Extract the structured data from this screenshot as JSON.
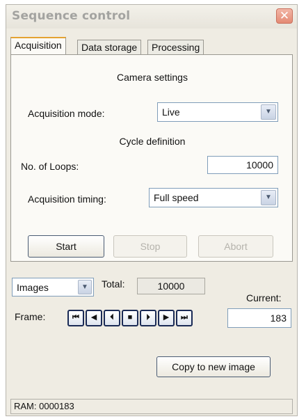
{
  "window": {
    "title": "Sequence control",
    "close_glyph": "✕"
  },
  "tabs": [
    {
      "label": "Acquisition",
      "active": true
    },
    {
      "label": "Data storage",
      "active": false
    },
    {
      "label": "Processing",
      "active": false
    }
  ],
  "acquisition": {
    "camera_settings_heading": "Camera settings",
    "mode_label": "Acquisition mode:",
    "mode_value": "Live",
    "cycle_heading": "Cycle definition",
    "loops_label": "No. of Loops:",
    "loops_value": "10000",
    "timing_label": "Acquisition timing:",
    "timing_value": "Full speed",
    "start_label": "Start",
    "stop_label": "Stop",
    "abort_label": "Abort"
  },
  "bottom": {
    "view_select_value": "Images",
    "total_label": "Total:",
    "total_value": "10000",
    "current_label": "Current:",
    "frame_label": "Frame:",
    "current_value": "183",
    "copy_button_label": "Copy to new image",
    "media_buttons": [
      {
        "name": "first-frame-icon",
        "glyph": "⏮"
      },
      {
        "name": "play-backward-icon",
        "glyph": "◀"
      },
      {
        "name": "step-back-icon",
        "glyph": "⏴"
      },
      {
        "name": "stop-icon",
        "glyph": "■"
      },
      {
        "name": "step-forward-icon",
        "glyph": "⏵"
      },
      {
        "name": "play-forward-icon",
        "glyph": "▶"
      },
      {
        "name": "last-frame-icon",
        "glyph": "⏭"
      }
    ]
  },
  "status_bar": {
    "ram_text": "RAM: 0000183"
  },
  "icons": {
    "dropdown_arrow": "chevron-down-icon",
    "close": "close-icon"
  },
  "colors": {
    "active_tab_accent": "#e4a332",
    "window_bg": "#efece3",
    "close_button": "#e48a74"
  }
}
